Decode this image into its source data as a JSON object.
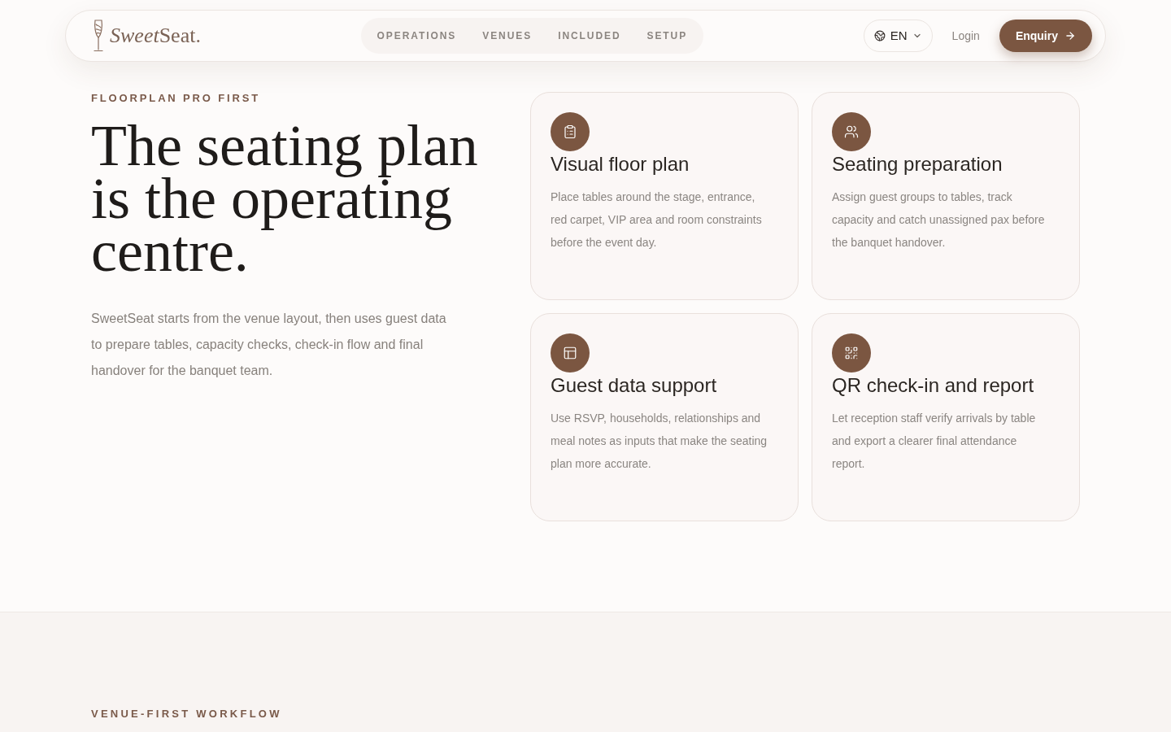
{
  "header": {
    "logo": {
      "script": "Sweet",
      "serif": "Seat."
    },
    "nav": [
      {
        "label": "OPERATIONS"
      },
      {
        "label": "VENUES"
      },
      {
        "label": "INCLUDED"
      },
      {
        "label": "SETUP"
      }
    ],
    "language": "EN",
    "login": "Login",
    "cta": "Enquiry"
  },
  "hero": {
    "eyebrow": "FLOORPLAN PRO FIRST",
    "title": "The seating plan is the operating centre.",
    "description": "SweetSeat starts from the venue layout, then uses guest data to prepare tables, capacity checks, check-in flow and final handover for the banquet team."
  },
  "features": [
    {
      "title": "Visual floor plan",
      "description": "Place tables around the stage, entrance, red carpet, VIP area and room constraints before the event day."
    },
    {
      "title": "Seating preparation",
      "description": "Assign guest groups to tables, track capacity and catch unassigned pax before the banquet handover."
    },
    {
      "title": "Guest data support",
      "description": "Use RSVP, households, relationships and meal notes as inputs that make the seating plan more accurate."
    },
    {
      "title": "QR check-in and report",
      "description": "Let reception staff verify arrivals by table and export a clearer final attendance report."
    }
  ],
  "workflow": {
    "eyebrow": "VENUE-FIRST WORKFLOW"
  }
}
